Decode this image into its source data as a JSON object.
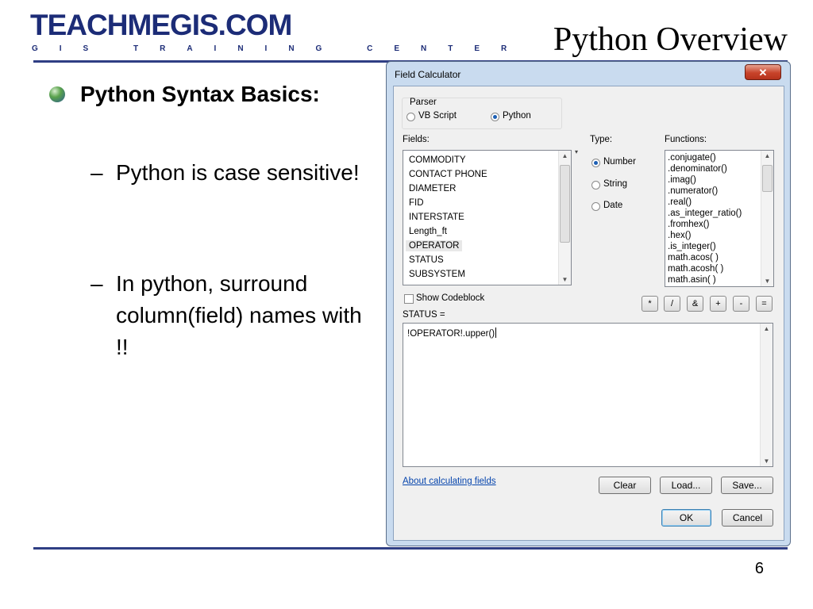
{
  "slide": {
    "logo_text": "TEACHMEGIS.COM",
    "logo_subtitle": "GIS TRAINING CENTER",
    "title": "Python Overview",
    "heading": "Python Syntax Basics:",
    "bullets": [
      {
        "dash": "–",
        "text": "Python is case sensitive!"
      },
      {
        "dash": "–",
        "text": "In python, surround column(field) names with !!"
      }
    ],
    "page_number": "6",
    "colors": {
      "brand": "#1c2c77",
      "rule": "#2f3e84"
    }
  },
  "dialog": {
    "title": "Field Calculator",
    "close_label": "✕",
    "parser": {
      "label": "Parser",
      "options": [
        "VB Script",
        "Python"
      ],
      "selected": "Python"
    },
    "fields": {
      "label": "Fields:",
      "items": [
        "COMMODITY",
        "CONTACT PHONE",
        "DIAMETER",
        "FID",
        "INTERSTATE",
        "Length_ft",
        "OPERATOR",
        "STATUS",
        "SUBSYSTEM"
      ],
      "selected": "OPERATOR"
    },
    "type": {
      "label": "Type:",
      "options": [
        "Number",
        "String",
        "Date"
      ],
      "selected": "Number"
    },
    "functions": {
      "label": "Functions:",
      "items": [
        ".conjugate()",
        ".denominator()",
        ".imag()",
        ".numerator()",
        ".real()",
        ".as_integer_ratio()",
        ".fromhex()",
        ".hex()",
        ".is_integer()",
        "math.acos( )",
        "math.acosh( )",
        "math.asin( )"
      ]
    },
    "show_codeblock": {
      "label": "Show Codeblock",
      "checked": false
    },
    "operators": [
      "*",
      "/",
      "&",
      "+",
      "-",
      "="
    ],
    "expression_label": "STATUS =",
    "expression": "!OPERATOR!.upper()",
    "about_link": "About calculating fields",
    "buttons": {
      "clear": "Clear",
      "load": "Load...",
      "save": "Save...",
      "ok": "OK",
      "cancel": "Cancel"
    }
  }
}
